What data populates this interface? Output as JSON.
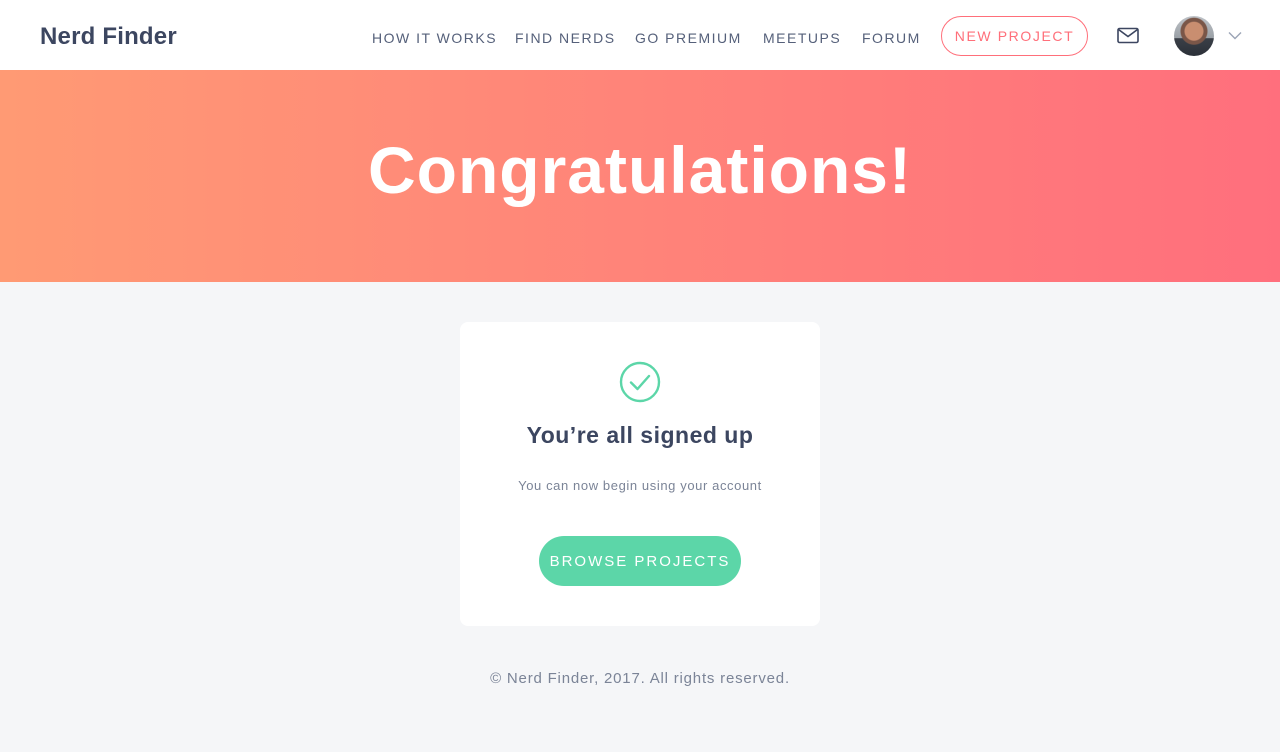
{
  "header": {
    "logo": "Nerd Finder",
    "nav": [
      "HOW IT WORKS",
      "FIND NERDS",
      "GO PREMIUM",
      "MEETUPS",
      "FORUM"
    ],
    "new_project_label": "NEW PROJECT",
    "icons": {
      "mail": "mail-icon",
      "avatar": "user-avatar",
      "menu": "chevron-down-icon"
    }
  },
  "hero": {
    "title": "Congratulations!"
  },
  "card": {
    "icon": "check-circle-icon",
    "title": "You’re all signed up",
    "subtitle": "You can now begin using your account",
    "button_label": "BROWSE PROJECTS"
  },
  "footer": {
    "text": "© Nerd Finder, 2017. All rights reserved."
  },
  "colors": {
    "accent_red": "#ff6f7a",
    "accent_green": "#5cd6a8",
    "text_dark": "#3c4660",
    "background": "#f5f6f8"
  }
}
